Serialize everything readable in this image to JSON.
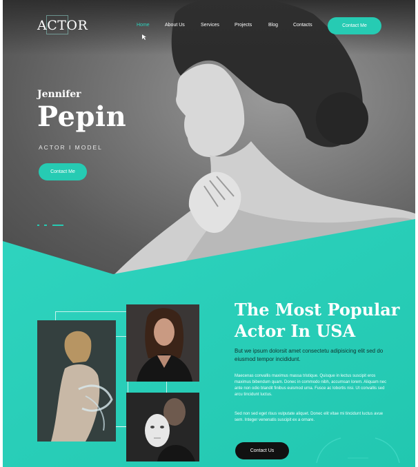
{
  "header": {
    "logo": "ACTOR",
    "nav": [
      "Home",
      "About Us",
      "Services",
      "Projects",
      "Blog",
      "Contacts"
    ],
    "contact_button": "Contact Me"
  },
  "hero": {
    "first_name": "Jennifer",
    "last_name": "Pepin",
    "roles": "ACTOR  I  MODEL",
    "button": "Contact Me"
  },
  "about": {
    "heading_line1": "The Most Popular",
    "heading_line2": "Actor In USA",
    "lead": "But we ipsum dolorsit amet consectetu adipisicing elit sed do eiusmod tempor incididunt.",
    "paragraph1": "Maecenas convallis maximus massa tristique. Quisque in lectus suscipit eros maximus bibendum quam. Donec in commodo nibh, accumsan lorem. Aliquam nec ante non odio blandit finibus euismod urna. Fusce ac lobortis nisi. Ut convallis sed arcu tincidunt luctus.",
    "paragraph2": "Sed non sed eget risus vulputate aliquet. Donec elit vitae mi tincidunt luctus avue sem. Integer venenatis suscipit ex a ornare.",
    "button": "Contact Us"
  },
  "colors": {
    "accent": "#26cbb3",
    "teal_bg": "#2ad1bb",
    "dark": "#111111"
  }
}
